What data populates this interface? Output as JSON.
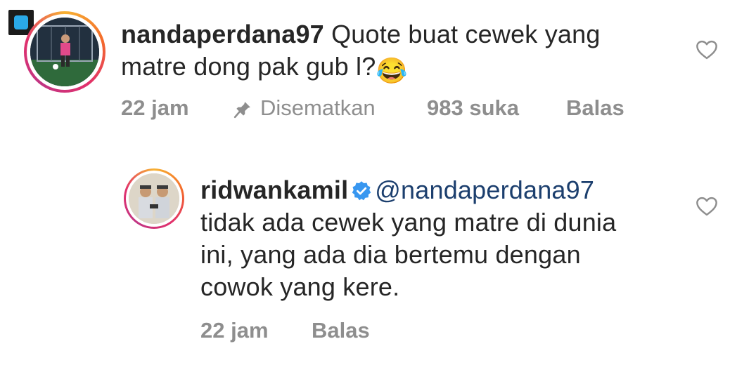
{
  "comments": [
    {
      "username": "nandaperdana97",
      "text_line1": "Quote buat cewek yang",
      "text_line2": "matre dong pak gub l?",
      "emoji": "😂",
      "time": "22 jam",
      "pinned_label": "Disematkan",
      "likes": "983 suka",
      "reply_label": "Balas"
    },
    {
      "username": "ridwankamil",
      "mention": "@nandaperdana97",
      "text_line1": "tidak ada cewek yang matre di dunia",
      "text_line2": "ini, yang ada dia bertemu dengan",
      "text_line3": "cowok yang kere.",
      "time": "22 jam",
      "reply_label": "Balas"
    }
  ],
  "colors": {
    "text": "#262626",
    "meta": "#8e8e8e",
    "mention": "#1c3f6e",
    "verified": "#3897f0"
  },
  "icons": [
    "pin-icon",
    "heart-outline-icon",
    "verified-badge-icon"
  ]
}
